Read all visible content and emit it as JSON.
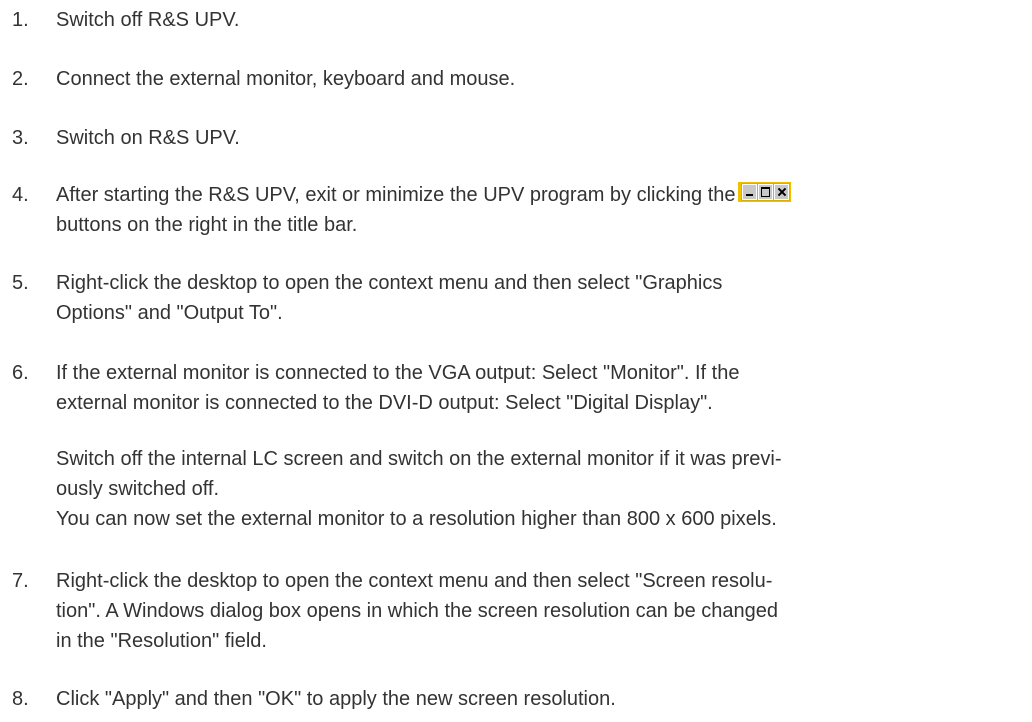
{
  "steps": [
    {
      "number": "1.",
      "lines": [
        "Switch off R&S UPV."
      ]
    },
    {
      "number": "2.",
      "lines": [
        "Connect the external monitor, keyboard and mouse."
      ]
    },
    {
      "number": "3.",
      "lines": [
        "Switch on R&S UPV."
      ]
    },
    {
      "number": "4.",
      "line1": "After starting the R&S UPV, exit or minimize the UPV program by clicking the",
      "line2": "buttons on the right in the title bar."
    },
    {
      "number": "5.",
      "lines": [
        "Right-click the desktop to open the context menu and then select \"Graphics",
        "Options\" and \"Output To\"."
      ]
    },
    {
      "number": "6.",
      "lines": [
        "If the external monitor is connected to the VGA output: Select \"Monitor\". If the",
        "external monitor is connected to the DVI-D output: Select \"Digital Display\"."
      ]
    },
    {
      "number": "7.",
      "lines": [
        "Right-click the desktop to open the context menu and then select \"Screen resolu-",
        "tion\". A Windows dialog box opens in which the screen resolution can be changed",
        "in the \"Resolution\" field."
      ]
    },
    {
      "number": "8.",
      "lines": [
        "Click \"Apply\" and then \"OK\" to apply the new screen resolution."
      ]
    }
  ],
  "step6_result": [
    "Switch off the internal LC screen and switch on the external monitor if it was previ-",
    "ously switched off.",
    "You can now set the external monitor to a resolution higher than 800 x 600 pixels."
  ],
  "icons": {
    "title_bar_buttons": "minimize-maximize-close-icon"
  },
  "colors": {
    "text": "#333333",
    "icon_frame": "#f0c000"
  }
}
